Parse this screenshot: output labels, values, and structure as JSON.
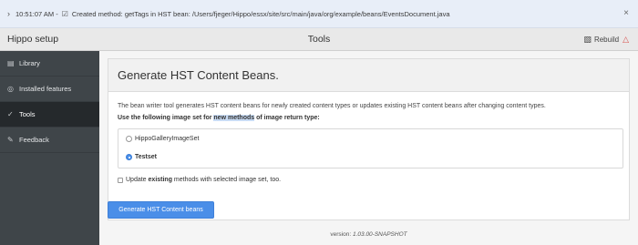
{
  "notification": {
    "time": "10:51:07 AM -",
    "message": "Created method: getTags in HST bean: /Users/fjeger/Hippo/essx/site/src/main/java/org/example/beans/EventsDocument.java",
    "close_glyph": "×"
  },
  "header": {
    "app_title": "Hippo setup",
    "page_title": "Tools",
    "rebuild_label": "Rebuild"
  },
  "sidebar": {
    "items": [
      {
        "label": "Library",
        "icon": "library-icon"
      },
      {
        "label": "Installed features",
        "icon": "features-icon"
      },
      {
        "label": "Tools",
        "icon": "tools-icon",
        "active": true
      },
      {
        "label": "Feedback",
        "icon": "feedback-icon"
      }
    ]
  },
  "panel": {
    "title": "Generate HST Content Beans.",
    "description": "The bean writer tool generates HST content beans for newly created content types or updates existing HST content beans after changing content types.",
    "image_set_label_before": "Use the following image set for ",
    "image_set_label_highlight": "new methods",
    "image_set_label_after": " of image return type:",
    "options": [
      {
        "label": "HippoGalleryImageSet",
        "selected": false
      },
      {
        "label": "Testset",
        "selected": true
      }
    ],
    "update_label_before": "Update ",
    "update_label_bold": "existing",
    "update_label_after": " methods with selected image set, too.",
    "generate_button": "Generate HST Content beans"
  },
  "footer": {
    "version_prefix": "version: ",
    "version_value": "1.03.00-SNAPSHOT"
  }
}
